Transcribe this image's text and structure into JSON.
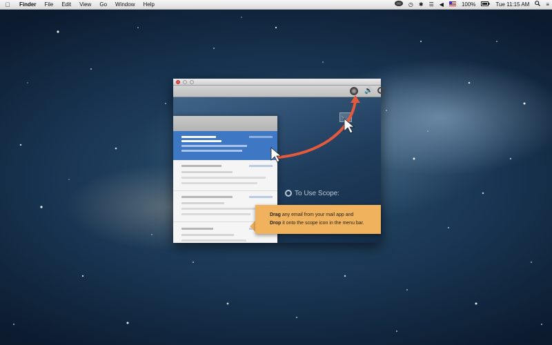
{
  "menubar": {
    "apple_icon": "apple-icon",
    "app_name": "Finder",
    "menus": [
      "File",
      "Edit",
      "View",
      "Go",
      "Window",
      "Help"
    ],
    "status": {
      "scope_icon": "scope-icon",
      "time_machine_icon": "time-machine-icon",
      "bluetooth_icon": "bluetooth-icon",
      "wifi_icon": "wifi-icon",
      "volume_icon": "volume-icon",
      "flag_icon": "us-flag-icon",
      "battery_percent": "100%",
      "clock": "Tue 11:15 AM",
      "spotlight_icon": "spotlight-icon",
      "list_icon": "notification-center-icon"
    }
  },
  "window": {
    "traffic_lights": [
      "close",
      "minimize",
      "zoom"
    ],
    "fake_menubar_icons": [
      "scope-icon",
      "speaker-icon",
      "clock-icon"
    ],
    "instructions": {
      "title": "To Use Scope:",
      "drag_word": "Drag",
      "drag_rest": " any email from your mail app and",
      "drop_word": "Drop",
      "drop_rest": " it onto the scope icon in the menu bar."
    }
  },
  "colors": {
    "selection_blue": "#3e78c4",
    "callout_orange": "#f0b25d",
    "arrow_red": "#e5593c",
    "close_red": "#e2544b"
  }
}
